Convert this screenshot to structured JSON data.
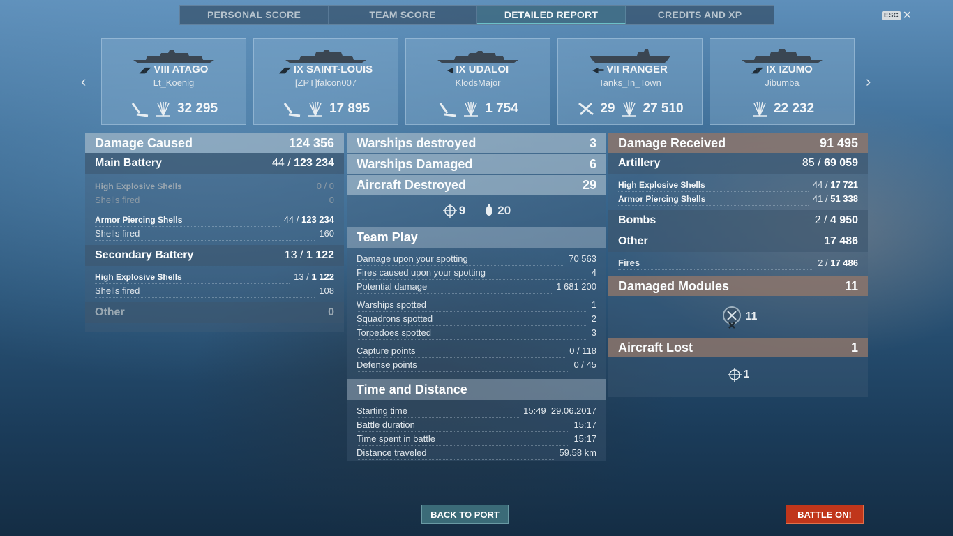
{
  "tabs": [
    "PERSONAL SCORE",
    "TEAM SCORE",
    "DETAILED REPORT",
    "CREDITS AND XP"
  ],
  "esc_label": "ESC",
  "ships": [
    {
      "name": "VIII ATAGO",
      "player": "Lt_Koenig",
      "stats": [
        "32 295"
      ]
    },
    {
      "name": "IX SAINT-LOUIS",
      "player": "[ZPT]falcon007",
      "stats": [
        "17 895"
      ]
    },
    {
      "name": "IX UDALOI",
      "player": "KlodsMajor",
      "stats": [
        "1 754"
      ]
    },
    {
      "name": "VII RANGER",
      "player": "Tanks_In_Town",
      "stats": [
        "29",
        "27 510"
      ]
    },
    {
      "name": "IX IZUMO",
      "player": "Jibumba",
      "stats": [
        "22 232"
      ]
    }
  ],
  "left": {
    "damage_caused": {
      "label": "Damage Caused",
      "value": "124 356"
    },
    "main_battery": {
      "label": "Main Battery",
      "hits": "44",
      "value": "123 234"
    },
    "he": {
      "label": "High Explosive Shells",
      "value": "0 / 0"
    },
    "he_fired": {
      "label": "Shells fired",
      "value": "0"
    },
    "ap": {
      "label": "Armor Piercing Shells",
      "hits": "44",
      "value": "123 234"
    },
    "ap_fired": {
      "label": "Shells fired",
      "value": "160"
    },
    "secondary": {
      "label": "Secondary Battery",
      "hits": "13",
      "value": "1 122"
    },
    "sec_he": {
      "label": "High Explosive Shells",
      "hits": "13",
      "value": "1 122"
    },
    "sec_fired": {
      "label": "Shells fired",
      "value": "108"
    },
    "other": {
      "label": "Other",
      "value": "0"
    }
  },
  "middle": {
    "destroyed": {
      "label": "Warships destroyed",
      "value": "3"
    },
    "damaged": {
      "label": "Warships Damaged",
      "value": "6"
    },
    "aircraft": {
      "label": "Aircraft Destroyed",
      "value": "29"
    },
    "aircraft_icons": [
      "9",
      "20"
    ],
    "team_play": "Team Play",
    "team_rows": [
      {
        "label": "Damage upon your spotting",
        "value": "70 563"
      },
      {
        "label": "Fires caused upon your spotting",
        "value": "4"
      },
      {
        "label": "Potential damage",
        "value": "1 681 200"
      }
    ],
    "spot_rows": [
      {
        "label": "Warships spotted",
        "value": "1"
      },
      {
        "label": "Squadrons spotted",
        "value": "2"
      },
      {
        "label": "Torpedoes spotted",
        "value": "3"
      }
    ],
    "cap_rows": [
      {
        "label": "Capture points",
        "value": "0 / 118"
      },
      {
        "label": "Defense points",
        "value": "0 / 45"
      }
    ],
    "time_title": "Time and Distance",
    "time_rows": [
      {
        "label": "Starting time",
        "value": "15:49  29.06.2017"
      },
      {
        "label": "Battle duration",
        "value": "15:17"
      },
      {
        "label": "Time spent in battle",
        "value": "15:17"
      },
      {
        "label": "Distance traveled",
        "value": "59.58 km"
      }
    ]
  },
  "right": {
    "received": {
      "label": "Damage Received",
      "value": "91 495"
    },
    "artillery": {
      "label": "Artillery",
      "hits": "85",
      "value": "69 059"
    },
    "he": {
      "label": "High Explosive Shells",
      "hits": "44",
      "value": "17 721"
    },
    "ap": {
      "label": "Armor Piercing Shells",
      "hits": "41",
      "value": "51 338"
    },
    "bombs": {
      "label": "Bombs",
      "hits": "2",
      "value": "4 950"
    },
    "other": {
      "label": "Other",
      "value": "17 486"
    },
    "fires": {
      "label": "Fires",
      "hits": "2",
      "value": "17 486"
    },
    "modules": {
      "label": "Damaged Modules",
      "value": "11"
    },
    "modules_icon": "11",
    "aircraft_lost": {
      "label": "Aircraft Lost",
      "value": "1"
    },
    "aircraft_lost_icon": "1"
  },
  "buttons": {
    "back": "BACK TO PORT",
    "battle": "BATTLE ON!"
  },
  "colors": {
    "battle_button": "#c0361b",
    "header_brown": "#96786a",
    "active_tab": "#6cc0c8"
  }
}
